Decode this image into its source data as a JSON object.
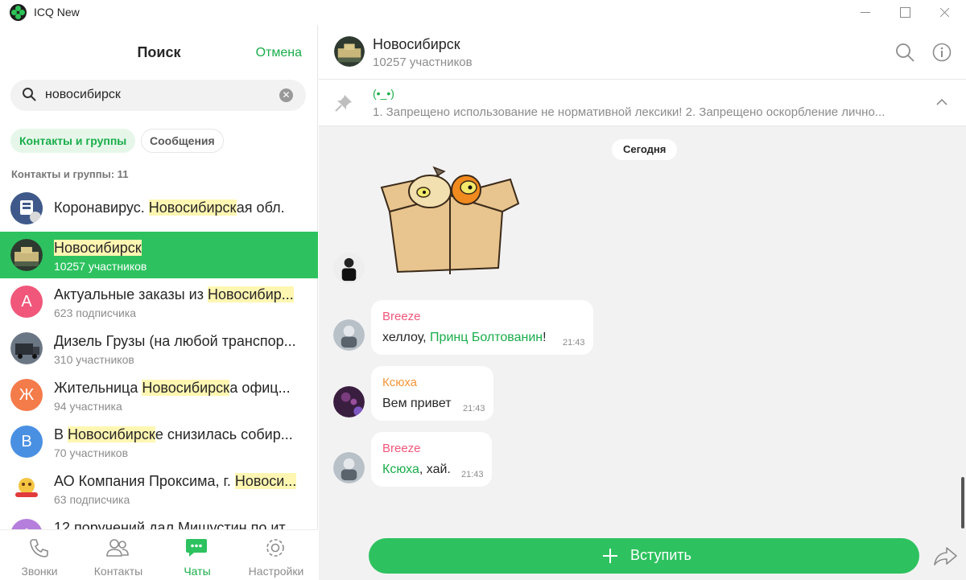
{
  "window": {
    "title": "ICQ New"
  },
  "search": {
    "title": "Поиск",
    "cancel_label": "Отмена",
    "query": "новосибирск",
    "filters": [
      "Контакты и группы",
      "Сообщения"
    ],
    "section_label": "Контакты и группы: 11"
  },
  "results": [
    {
      "pre": "Коронавирус. ",
      "hl": "Новосибирск",
      "post": "ая обл.",
      "sub": "",
      "avatar_color": "#3f5a8a",
      "avatar_letter": ""
    },
    {
      "pre": "",
      "hl": "Новосибирск",
      "post": "",
      "sub": "10257 участников",
      "avatar_color": "#3c4a3e",
      "avatar_letter": ""
    },
    {
      "pre": "Актуальные заказы  из ",
      "hl": "Новосибир...",
      "post": "",
      "sub": "623 подписчика",
      "avatar_color": "#f0577a",
      "avatar_letter": "А"
    },
    {
      "pre": "Дизель Грузы (на любой транспор...",
      "hl": "",
      "post": "",
      "sub": "310 участников",
      "avatar_color": "#4a5563",
      "avatar_letter": ""
    },
    {
      "pre": "Жительница ",
      "hl": "Новосибирск",
      "post": "а офиц...",
      "sub": "94 участника",
      "avatar_color": "#f47b4a",
      "avatar_letter": "Ж"
    },
    {
      "pre": "В ",
      "hl": "Новосибирск",
      "post": "е снизилась собир...",
      "sub": "70 участников",
      "avatar_color": "#4a90e2",
      "avatar_letter": "В"
    },
    {
      "pre": "АО Компания Проксима, г. ",
      "hl": "Новоси...",
      "post": "",
      "sub": "63 подписчика",
      "avatar_color": "#ffffff",
      "avatar_letter": ""
    },
    {
      "pre": "12 поручений дал Мишустин по ит...",
      "hl": "",
      "post": "",
      "sub": "",
      "avatar_color": "#b57edc",
      "avatar_letter": "1"
    }
  ],
  "nav": [
    {
      "label": "Звонки",
      "icon": "phone-icon"
    },
    {
      "label": "Контакты",
      "icon": "contacts-icon"
    },
    {
      "label": "Чаты",
      "icon": "chats-icon"
    },
    {
      "label": "Настройки",
      "icon": "settings-icon"
    }
  ],
  "chat": {
    "title": "Новосибирск",
    "members": "10257 участников",
    "pinned_title": "(•_•)",
    "pinned_text": "1. Запрещено использование не нормативной лексики! 2. Запрещено оскорбление лично...",
    "date_chip": "Сегодня",
    "join_label": "Вступить"
  },
  "messages": [
    {
      "author": "Breeze",
      "author_color": "#f0577a",
      "text_pre": "хеллоу, ",
      "mention": "Принц Болтованин",
      "text_post": "!",
      "time": "21:43"
    },
    {
      "author": "Ксюха",
      "author_color": "#f4963a",
      "text_pre": "Вем привет",
      "mention": "",
      "text_post": "",
      "time": "21:43"
    },
    {
      "author": "Breeze",
      "author_color": "#f0577a",
      "text_pre": "",
      "mention": "Ксюха",
      "text_post": ", хай.",
      "time": "21:43"
    }
  ],
  "colors": {
    "accent": "#2dc25f",
    "accent_text": "#1aad4a",
    "highlight": "#fff6b2"
  }
}
